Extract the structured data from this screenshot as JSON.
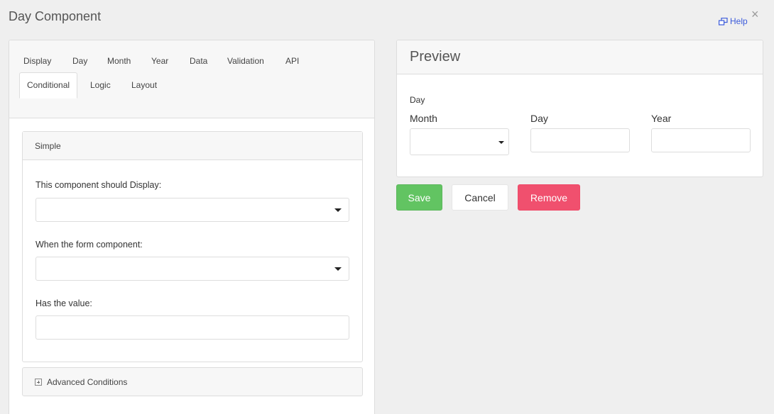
{
  "modal": {
    "title": "Day Component",
    "help_label": "Help",
    "close_glyph": "×"
  },
  "tabs": [
    {
      "label": "Display"
    },
    {
      "label": "Day"
    },
    {
      "label": "Month"
    },
    {
      "label": "Year"
    },
    {
      "label": "Data"
    },
    {
      "label": "Validation"
    },
    {
      "label": "API"
    },
    {
      "label": "Conditional",
      "active": true
    },
    {
      "label": "Logic"
    },
    {
      "label": "Layout"
    }
  ],
  "simple": {
    "header": "Simple",
    "display_label": "This component should Display:",
    "display_value": "",
    "when_label": "When the form component:",
    "when_value": "",
    "value_label": "Has the value:",
    "value_value": ""
  },
  "advanced": {
    "label": "Advanced Conditions",
    "icon": "plus-square-icon"
  },
  "preview": {
    "title": "Preview",
    "component_label": "Day",
    "month_label": "Month",
    "day_label": "Day",
    "year_label": "Year",
    "month_value": "",
    "day_value": "",
    "year_value": ""
  },
  "buttons": {
    "save": "Save",
    "cancel": "Cancel",
    "remove": "Remove"
  },
  "colors": {
    "save": "#62c462",
    "remove": "#f0506e",
    "link": "#3b5bdb"
  }
}
